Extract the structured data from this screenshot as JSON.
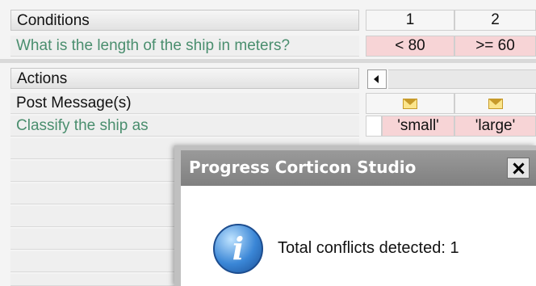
{
  "conditions": {
    "header": "Conditions",
    "question": "What is the length of the ship in meters?",
    "columns": [
      "1",
      "2"
    ],
    "values": [
      "< 80",
      ">= 60"
    ]
  },
  "actions": {
    "header": "Actions",
    "post_message": "Post Message(s)",
    "classify": "Classify the ship as",
    "values": [
      "'small'",
      "'large'"
    ]
  },
  "dialog": {
    "title": "Progress Corticon Studio",
    "message": "Total conflicts detected: 1",
    "icon": "info-icon"
  }
}
